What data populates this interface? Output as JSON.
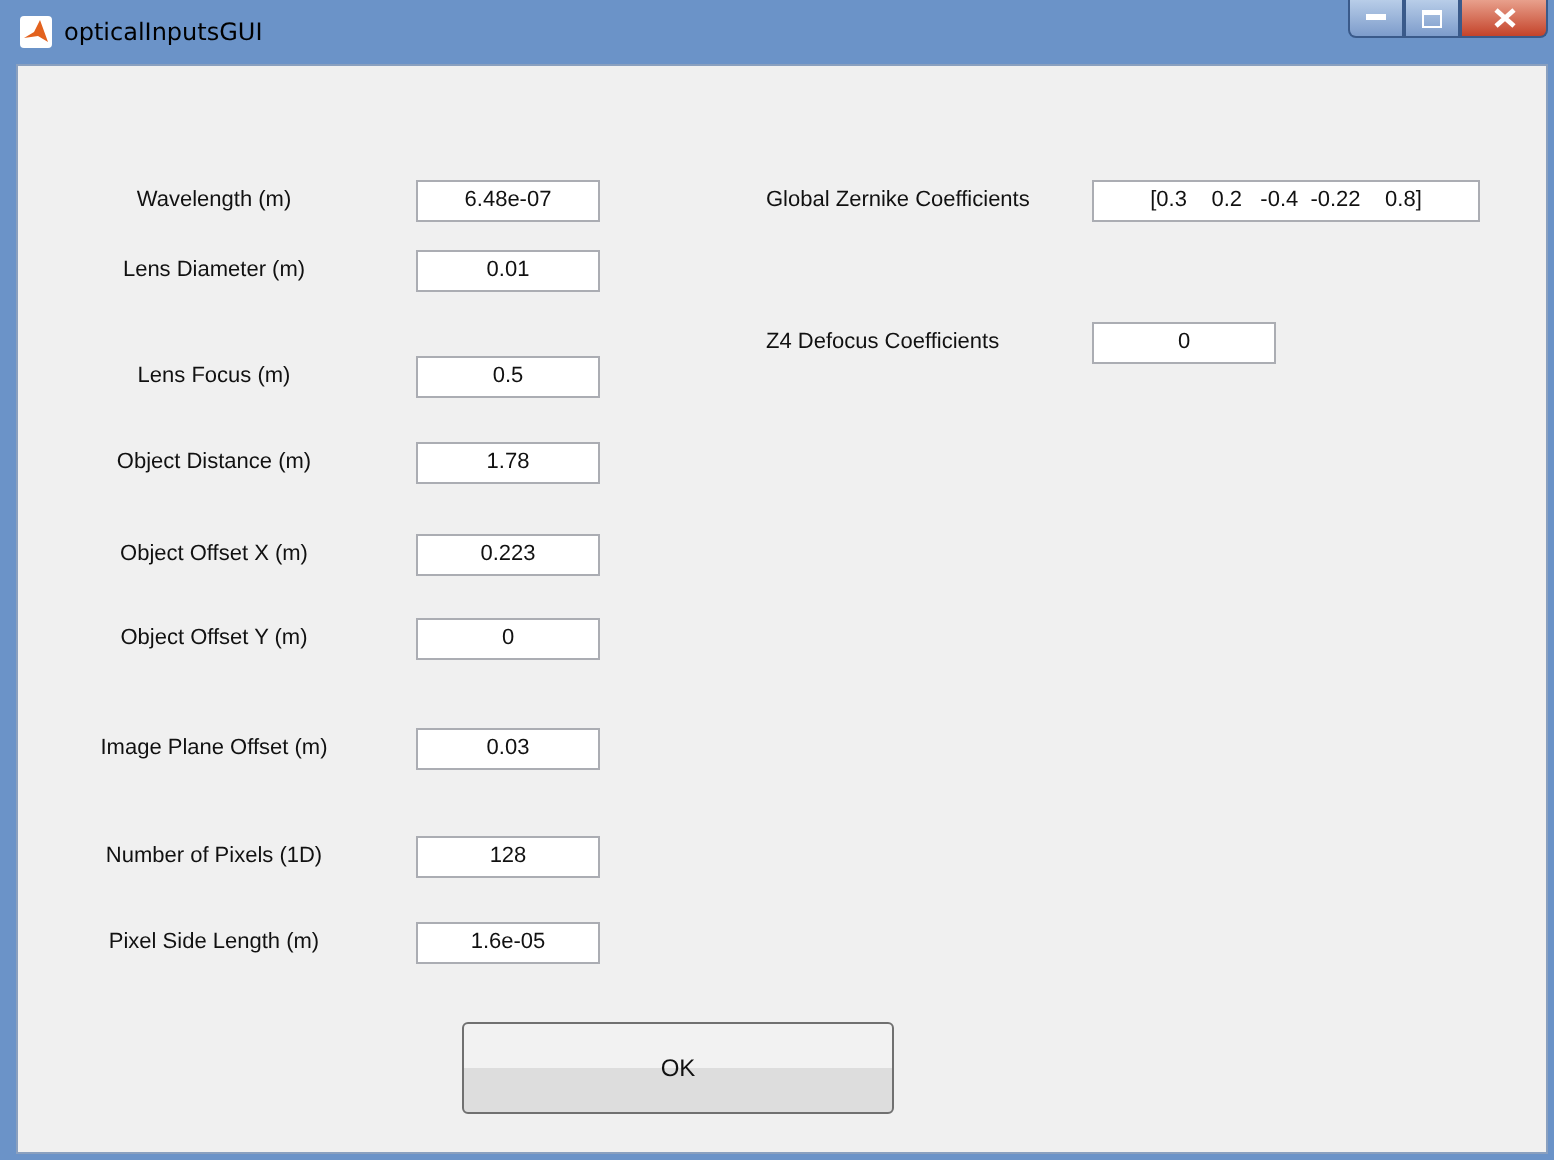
{
  "window": {
    "title": "opticalInputsGUI"
  },
  "left_fields": [
    {
      "label": "Wavelength (m)",
      "value": "6.48e-07"
    },
    {
      "label": "Lens Diameter (m)",
      "value": "0.01"
    },
    {
      "label": "Lens Focus (m)",
      "value": "0.5"
    },
    {
      "label": "Object Distance (m)",
      "value": "1.78"
    },
    {
      "label": "Object Offset X (m)",
      "value": "0.223"
    },
    {
      "label": "Object Offset Y (m)",
      "value": "0"
    },
    {
      "label": "Image Plane Offset  (m)",
      "value": "0.03"
    },
    {
      "label": "Number of Pixels (1D)",
      "value": "128"
    },
    {
      "label": "Pixel Side Length (m)",
      "value": "1.6e-05"
    }
  ],
  "right_fields": [
    {
      "label": "Global Zernike Coefficients",
      "value": "[0.3    0.2   -0.4  -0.22    0.8]"
    },
    {
      "label": "Z4 Defocus Coefficients",
      "value": "0"
    }
  ],
  "buttons": [
    "OK"
  ]
}
